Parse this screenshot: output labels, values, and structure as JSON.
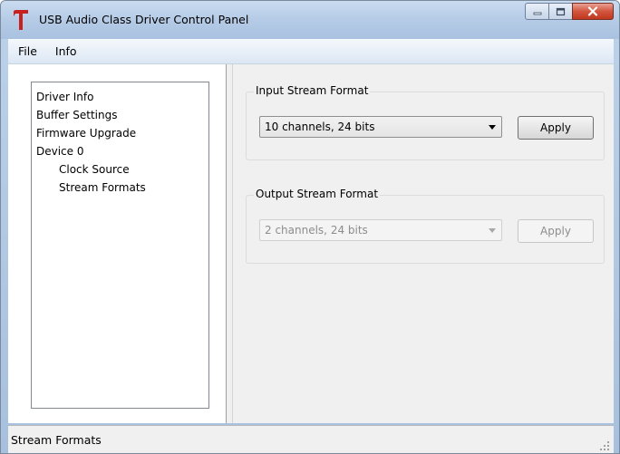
{
  "window": {
    "title": "USB Audio Class Driver Control Panel",
    "logo_icon": "red-t-logo-icon",
    "buttons": [
      "minimize-icon",
      "maximize-icon",
      "close-icon"
    ]
  },
  "menu": {
    "items": [
      {
        "label": "File"
      },
      {
        "label": "Info"
      }
    ]
  },
  "tree": {
    "items": [
      {
        "label": "Driver Info",
        "level": 0
      },
      {
        "label": "Buffer Settings",
        "level": 0
      },
      {
        "label": "Firmware Upgrade",
        "level": 0
      },
      {
        "label": "Device 0",
        "level": 0
      },
      {
        "label": "Clock Source",
        "level": 1
      },
      {
        "label": "Stream Formats",
        "level": 1
      }
    ]
  },
  "input_stream": {
    "label": "Input Stream Format",
    "selected": "10 channels, 24 bits",
    "apply_label": "Apply",
    "enabled": true
  },
  "output_stream": {
    "label": "Output Stream Format",
    "selected": "2 channels, 24 bits",
    "apply_label": "Apply",
    "enabled": false
  },
  "status": {
    "text": "Stream Formats"
  },
  "colors": {
    "logo": "#c8201e",
    "close_button": "#c94a33"
  }
}
